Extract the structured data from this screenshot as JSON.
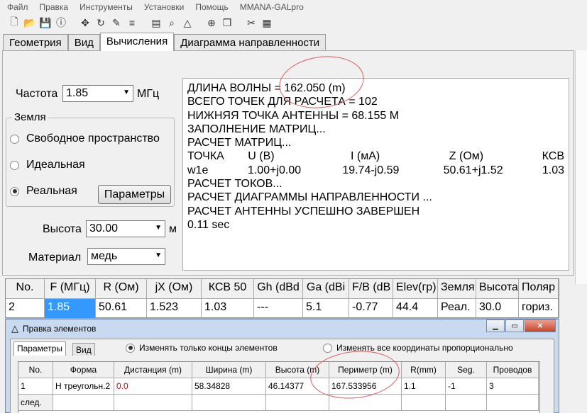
{
  "menu": [
    "Файл",
    "Правка",
    "Инструменты",
    "Установки",
    "Помощь",
    "MMANA-GALpro"
  ],
  "toolbar_icons": [
    "new-file-icon",
    "open-folder-icon",
    "save-icon",
    "info-icon",
    "move-icon",
    "rotate-icon",
    "edit-icon",
    "wire-icon",
    "document-icon",
    "zoom-icon",
    "triangle-icon",
    "target-icon",
    "copy-icon",
    "tools-icon",
    "calculator-icon"
  ],
  "tabs": [
    "Геометрия",
    "Вид",
    "Вычисления",
    "Диаграмма направленности"
  ],
  "freq": {
    "label": "Частота",
    "value": "1.85",
    "unit": "МГц"
  },
  "ground": {
    "title": "Земля",
    "options": [
      "Свободное пространство",
      "Идеальная",
      "Реальная"
    ],
    "selected": 2,
    "params_button": "Параметры"
  },
  "height": {
    "label": "Высота",
    "value": "30.00",
    "unit": "м"
  },
  "material": {
    "label": "Материал",
    "value": "медь"
  },
  "output": {
    "lines": [
      "ДЛИНА ВОЛНЫ = 162.050 (m)",
      "ВСЕГО ТОЧЕК ДЛЯ РАСЧЕТА = 102",
      "НИЖНЯЯ ТОЧКА АНТЕННЫ = 68.155 М",
      "ЗАПОЛНЕНИЕ МАТРИЦ...",
      "РАСЧЕТ МАТРИЦ..."
    ],
    "table_header": [
      "ТОЧКА",
      "U (B)",
      "I (мА)",
      "Z (Ом)",
      "КСВ"
    ],
    "table_row": [
      "w1e",
      "1.00+j0.00",
      "19.74-j0.59",
      "50.61+j1.52",
      "1.03"
    ],
    "tail": [
      "РАСЧЕТ ТОКОВ...",
      "РАСЧЕТ ДИАГРАММЫ НАПРАВЛЕННОСТИ ...",
      "РАСЧЕТ АНТЕННЫ УСПЕШНО ЗАВЕРШЕН",
      "0.11 sec"
    ]
  },
  "results": {
    "headers": [
      "No.",
      "F (МГц)",
      "R (Ом)",
      "jX (Ом)",
      "КСВ 50",
      "Gh (dBd",
      "Ga (dBi",
      "F/B (dB",
      "Elev(гр)",
      "Земля",
      "Высота",
      "Поляр"
    ],
    "row": [
      "2",
      "1.85",
      "50.61",
      "1.523",
      "1.03",
      "---",
      "5.1",
      "-0.77",
      "44.4",
      "Реал.",
      "30.0",
      "гориз."
    ]
  },
  "dialog": {
    "title": "Правка элементов",
    "tabs": [
      "Параметры",
      "Вид"
    ],
    "radio1": "Изменять только концы элементов",
    "radio2": "Изменять все координаты пропорционально",
    "headers": [
      "No.",
      "Форма",
      "Дистанция (m)",
      "Ширина (m)",
      "Высота (m)",
      "Периметр (m)",
      "R(mm)",
      "Seg.",
      "Проводов"
    ],
    "row": [
      "1",
      "Н треугольн.2",
      "0.0",
      "58.34828",
      "46.14377",
      "167.533956",
      "1.1",
      "-1",
      "3"
    ],
    "next_label": "след."
  },
  "colors": {
    "selection": "#3399ff",
    "red_value": "#d00000",
    "annotation": "#e05a5a"
  }
}
